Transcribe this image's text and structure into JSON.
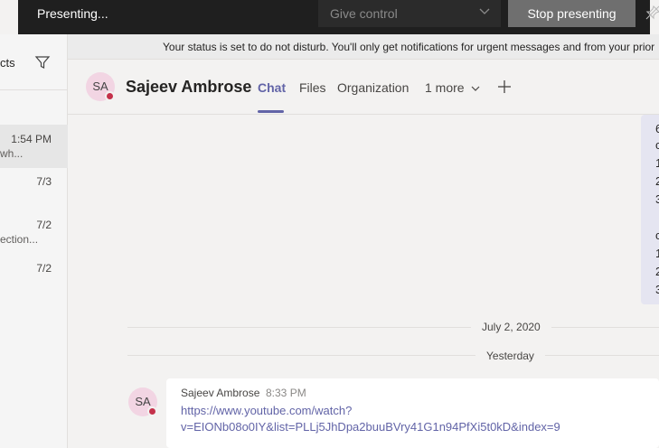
{
  "presenting_bar": {
    "status": "Presenting...",
    "give_control": "Give control",
    "stop_presenting": "Stop presenting"
  },
  "left_pane": {
    "header_text": "cts",
    "items": [
      {
        "time": "1:54 PM",
        "preview": "wh..."
      },
      {
        "time": "7/3",
        "preview": ""
      },
      {
        "time": "7/2",
        "preview": "ection..."
      },
      {
        "time": "7/2",
        "preview": ""
      }
    ]
  },
  "status_banner": "Your status is set to do not disturb. You'll only get notifications for urgent messages and from your prior",
  "chat_header": {
    "avatar_initials": "SA",
    "name": "Sajeev Ambrose",
    "tabs": [
      "Chat",
      "Files",
      "Organization",
      "1 more"
    ],
    "active_tab": "Chat"
  },
  "sent_message_fragments": [
    "6",
    "c",
    "1",
    "2",
    "3",
    "",
    "c",
    "1",
    "2",
    "3"
  ],
  "date_dividers": [
    "July 2, 2020",
    "Yesterday"
  ],
  "message": {
    "avatar_initials": "SA",
    "sender": "Sajeev Ambrose",
    "time": "8:33 PM",
    "link_line1": "https://www.youtube.com/watch?",
    "link_line2": "v=EIONb08o0IY&list=PLLj5JhDpa2buuBVry41G1n94PfXi5t0kD&index=9"
  },
  "colors": {
    "accent": "#6264a7",
    "presence_dnd": "#c4314b",
    "present_bar": "#1f1f1f"
  }
}
